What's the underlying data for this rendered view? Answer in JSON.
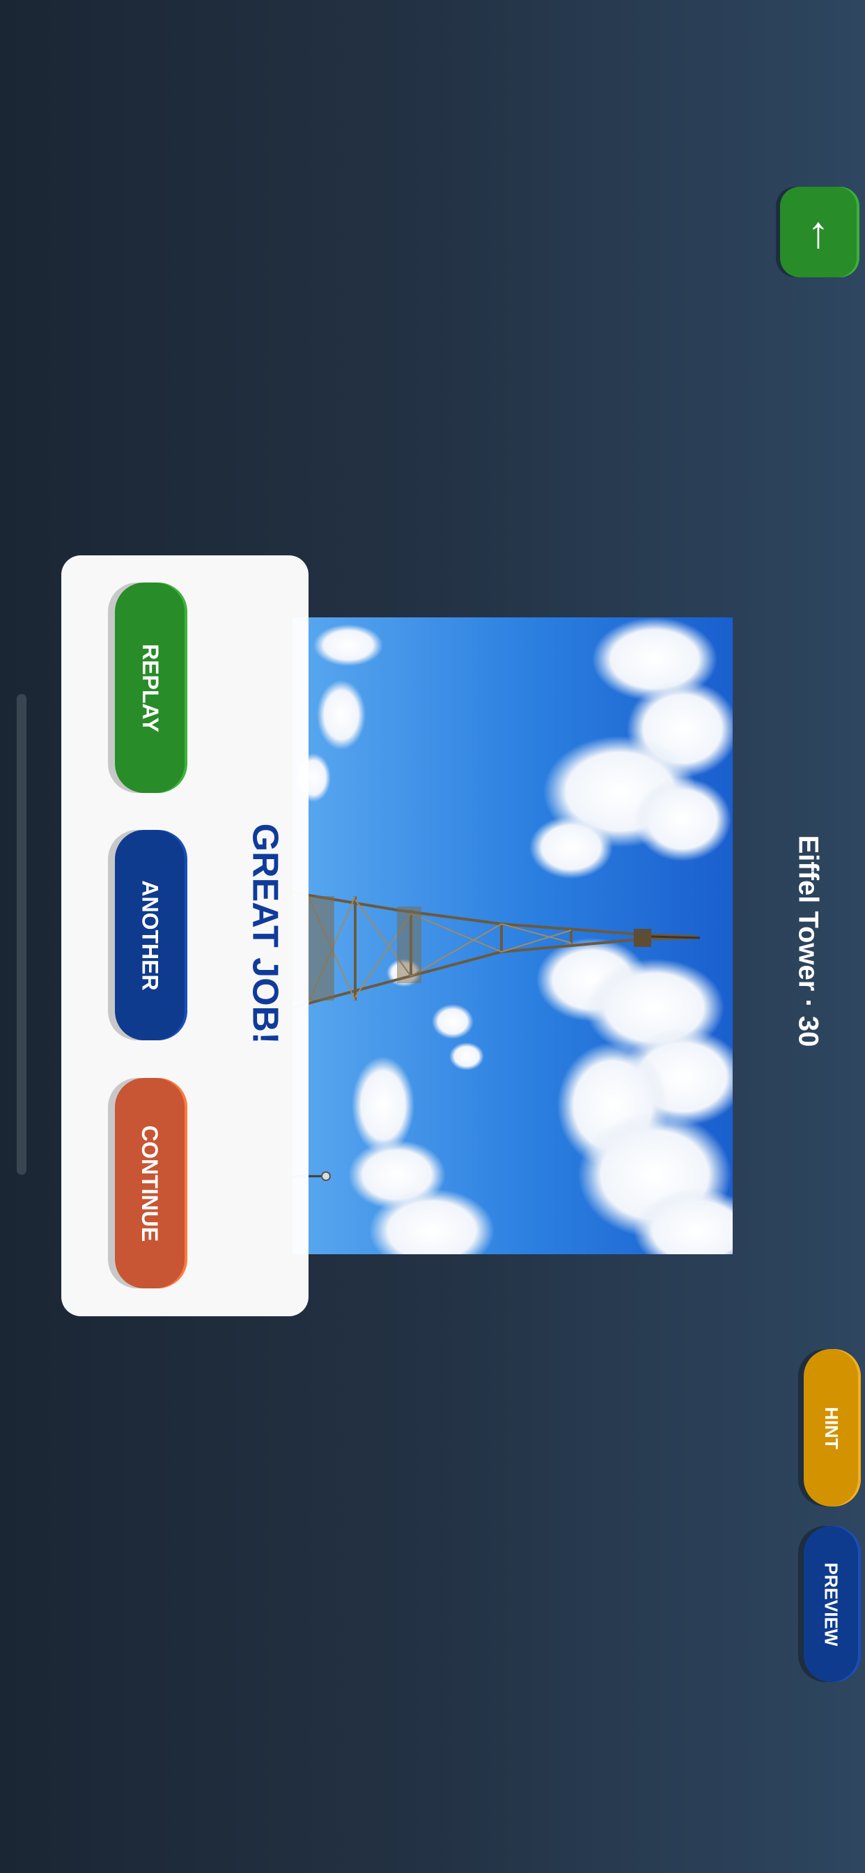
{
  "header": {
    "title": "Eiffel Tower · 30"
  },
  "top_button": {
    "icon": "↑",
    "icon_name": "up-arrow-icon"
  },
  "puzzle": {
    "image_subject": "Eiffel Tower against blue sky with clouds"
  },
  "dialog": {
    "title": "GREAT JOB!",
    "buttons": {
      "replay": "REPLAY",
      "another": "ANOTHER",
      "continue": "CONTINUE"
    }
  },
  "controls": {
    "hint": "HINT",
    "preview": "PREVIEW"
  },
  "colors": {
    "green": "#288c28",
    "blue": "#0f3b8f",
    "orange": "#c85533",
    "gold": "#d39200",
    "title_blue": "#0f3b9a"
  }
}
